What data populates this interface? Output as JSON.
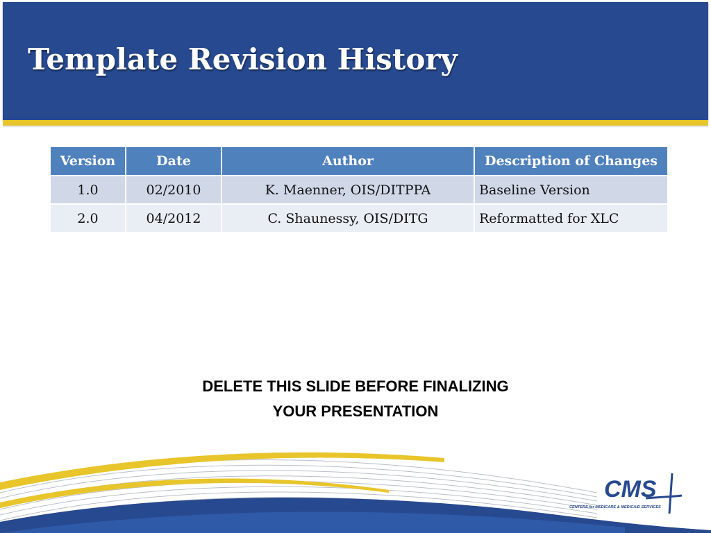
{
  "slide": {
    "title": "Template Revision History"
  },
  "table": {
    "headers": [
      "Version",
      "Date",
      "Author",
      "Description of Changes"
    ],
    "rows": [
      [
        "1.0",
        "02/2010",
        "K. Maenner, OIS/DITPPA",
        "Baseline Version"
      ],
      [
        "2.0",
        "04/2012",
        "C. Shaunessy, OIS/DITG",
        "Reformatted for XLC"
      ]
    ]
  },
  "notice": {
    "line1": "DELETE THIS SLIDE BEFORE FINALIZING",
    "line2": "YOUR PRESENTATION"
  },
  "logo": {
    "wordmark": "CMS",
    "tagline": "CENTERS for MEDICARE & MEDICAID SERVICES"
  },
  "colors": {
    "header_blue": "#27498f",
    "accent_gold": "#e8c52a",
    "table_header": "#4f81bd",
    "row_odd": "#d0d8e8",
    "row_even": "#e9edf4"
  }
}
